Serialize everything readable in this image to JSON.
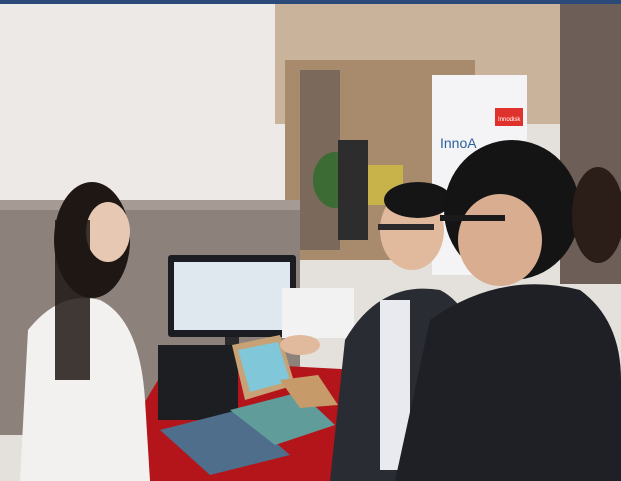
{
  "photo": {
    "banner_text": "InnoA",
    "banner_logo_text": "Innodisk",
    "colors": {
      "wall": "#e9e6e3",
      "granite": "#8a7f78",
      "floor_table": "#b3151b",
      "woman_top": "#f3f1ef",
      "man_jacket": "#2a2c33",
      "monitor_screen": "#dfe7ef",
      "tablet_screen": "#7fc7d9",
      "banner_accent": "#e0322d",
      "border": "#2b4a7a"
    }
  }
}
